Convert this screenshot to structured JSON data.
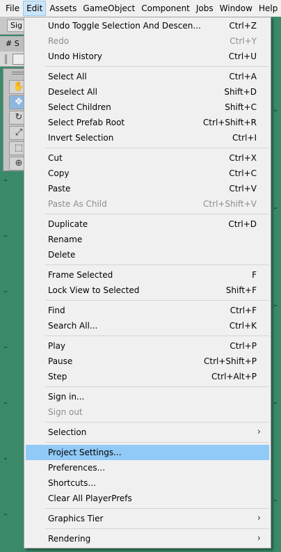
{
  "menubar": {
    "items": [
      "File",
      "Edit",
      "Assets",
      "GameObject",
      "Component",
      "Jobs",
      "Window",
      "Help"
    ]
  },
  "editor": {
    "sign_in_button": "Sig",
    "scene_tab": "# S"
  },
  "edit_menu": {
    "items": [
      {
        "label": "Undo Toggle Selection And Descen...",
        "shortcut": "Ctrl+Z"
      },
      {
        "label": "Redo",
        "shortcut": "Ctrl+Y"
      },
      {
        "label": "Undo History",
        "shortcut": "Ctrl+U"
      },
      {
        "label": "Select All",
        "shortcut": "Ctrl+A"
      },
      {
        "label": "Deselect All",
        "shortcut": "Shift+D"
      },
      {
        "label": "Select Children",
        "shortcut": "Shift+C"
      },
      {
        "label": "Select Prefab Root",
        "shortcut": "Ctrl+Shift+R"
      },
      {
        "label": "Invert Selection",
        "shortcut": "Ctrl+I"
      },
      {
        "label": "Cut",
        "shortcut": "Ctrl+X"
      },
      {
        "label": "Copy",
        "shortcut": "Ctrl+C"
      },
      {
        "label": "Paste",
        "shortcut": "Ctrl+V"
      },
      {
        "label": "Paste As Child",
        "shortcut": "Ctrl+Shift+V"
      },
      {
        "label": "Duplicate",
        "shortcut": "Ctrl+D"
      },
      {
        "label": "Rename",
        "shortcut": ""
      },
      {
        "label": "Delete",
        "shortcut": ""
      },
      {
        "label": "Frame Selected",
        "shortcut": "F"
      },
      {
        "label": "Lock View to Selected",
        "shortcut": "Shift+F"
      },
      {
        "label": "Find",
        "shortcut": "Ctrl+F"
      },
      {
        "label": "Search All...",
        "shortcut": "Ctrl+K"
      },
      {
        "label": "Play",
        "shortcut": "Ctrl+P"
      },
      {
        "label": "Pause",
        "shortcut": "Ctrl+Shift+P"
      },
      {
        "label": "Step",
        "shortcut": "Ctrl+Alt+P"
      },
      {
        "label": "Sign in...",
        "shortcut": ""
      },
      {
        "label": "Sign out",
        "shortcut": ""
      },
      {
        "label": "Selection",
        "shortcut": ""
      },
      {
        "label": "Project Settings...",
        "shortcut": ""
      },
      {
        "label": "Preferences...",
        "shortcut": ""
      },
      {
        "label": "Shortcuts...",
        "shortcut": ""
      },
      {
        "label": "Clear All PlayerPrefs",
        "shortcut": ""
      },
      {
        "label": "Graphics Tier",
        "shortcut": ""
      },
      {
        "label": "Rendering",
        "shortcut": ""
      }
    ]
  },
  "colors": {
    "highlight": "#91c9f7",
    "scene_background": "#3a8a6a",
    "disabled_text": "#8d8d8d"
  }
}
